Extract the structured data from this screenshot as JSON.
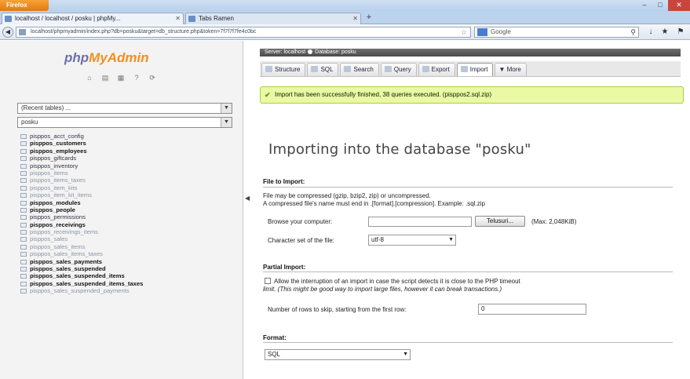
{
  "browser": {
    "app_button": "Firefox",
    "tabs": [
      {
        "label": "localhost / localhost / posku | phpMy..."
      },
      {
        "label": "Tabs Ramen"
      }
    ],
    "url": "localhost/phpmyadmin/index.php?db=posku&target=db_structure.php&token=7f7f7f7fe4c0bc",
    "search_placeholder": "Google"
  },
  "sidebar": {
    "logo_php": "php",
    "logo_myadmin": "MyAdmin",
    "server_select": "(Recent tables) ...",
    "db_select": "posku",
    "tables": [
      {
        "name": "pisppos_acct_config",
        "style": "n"
      },
      {
        "name": "pisppos_customers",
        "style": "b"
      },
      {
        "name": "pisppos_employees",
        "style": "b"
      },
      {
        "name": "pisppos_giftcards",
        "style": "n"
      },
      {
        "name": "pisppos_inventory",
        "style": "n"
      },
      {
        "name": "pisppos_items",
        "style": "f"
      },
      {
        "name": "pisppos_items_taxes",
        "style": "f"
      },
      {
        "name": "pisppos_item_kits",
        "style": "f"
      },
      {
        "name": "pisppos_item_kit_items",
        "style": "f"
      },
      {
        "name": "pisppos_modules",
        "style": "b"
      },
      {
        "name": "pisppos_people",
        "style": "b"
      },
      {
        "name": "pisppos_permissions",
        "style": "n"
      },
      {
        "name": "pisppos_receivings",
        "style": "b"
      },
      {
        "name": "pisppos_receivings_items",
        "style": "f"
      },
      {
        "name": "pisppos_sales",
        "style": "f"
      },
      {
        "name": "pisppos_sales_items",
        "style": "f"
      },
      {
        "name": "pisppos_sales_items_taxes",
        "style": "f"
      },
      {
        "name": "pisppos_sales_payments",
        "style": "b"
      },
      {
        "name": "pisppos_sales_suspended",
        "style": "b"
      },
      {
        "name": "pisppos_sales_suspended_items",
        "style": "b"
      },
      {
        "name": "pisppos_sales_suspended_items_taxes",
        "style": "b"
      },
      {
        "name": "pisppos_sales_suspended_payments",
        "style": "f"
      }
    ]
  },
  "main": {
    "breadcrumb_server": "Server: localhost",
    "breadcrumb_db": "Database: posku",
    "menu": [
      {
        "label": "Structure"
      },
      {
        "label": "SQL"
      },
      {
        "label": "Search"
      },
      {
        "label": "Query"
      },
      {
        "label": "Export"
      },
      {
        "label": "Import"
      },
      {
        "label": "More"
      }
    ],
    "notice": "Import has been successfully finished, 38 queries executed. (pisppos2.sql.zip)",
    "title": "Importing into the database \"posku\"",
    "file_section": {
      "heading": "File to Import:",
      "line1": "File may be compressed (gzip, bzip2, zip) or uncompressed.",
      "line2": "A compressed file's name must end in .[format].[compression]. Example: .sql.zip",
      "browse_label": "Browse your computer:",
      "browse_button": "Telusuri...",
      "max_size": "(Max: 2,048KiB)",
      "charset_label": "Character set of the file:",
      "charset_value": "utf-8"
    },
    "partial_section": {
      "heading": "Partial Import:",
      "line1": "Allow the interruption of an import in case the script detects it is close to the PHP timeout",
      "line2": "limit. (This might be good way to import large files, however it can break transactions.)",
      "skip_label": "Number of rows to skip, starting from the first row:",
      "skip_value": "0"
    },
    "format_section": {
      "heading": "Format:",
      "format_value": "SQL"
    }
  }
}
